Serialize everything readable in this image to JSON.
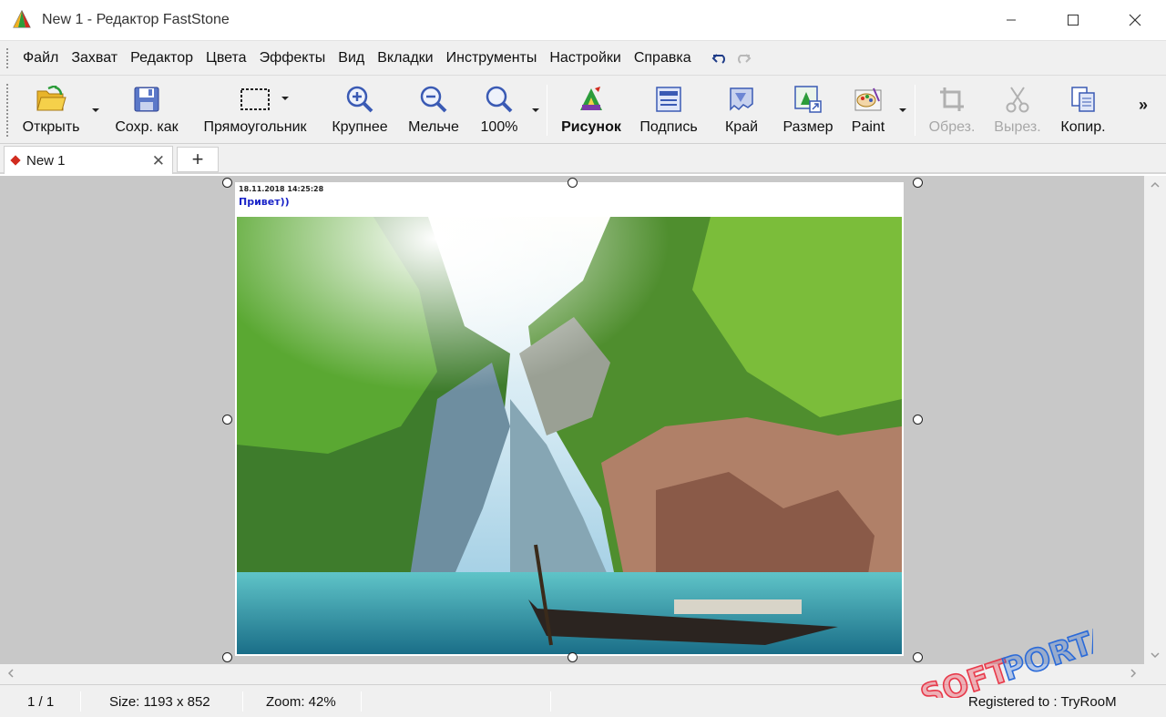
{
  "window": {
    "title": "New 1 - Редактор FastStone",
    "controls": [
      "minimize",
      "maximize",
      "close"
    ]
  },
  "menu": {
    "items": [
      "Файл",
      "Захват",
      "Редактор",
      "Цвета",
      "Эффекты",
      "Вид",
      "Вкладки",
      "Инструменты",
      "Настройки",
      "Справка"
    ],
    "undo_icon": "undo-icon",
    "redo_icon": "redo-icon"
  },
  "toolbar": {
    "open": "Открыть",
    "save_as": "Сохр. как",
    "rectangle": "Прямоугольник",
    "zoom_in": "Крупнее",
    "zoom_out": "Мельче",
    "zoom_100": "100%",
    "draw": "Рисунок",
    "caption": "Подпись",
    "edge": "Край",
    "resize": "Размер",
    "paint": "Paint",
    "crop": "Обрез.",
    "cut": "Вырез.",
    "copy": "Копир.",
    "more": "»"
  },
  "tabs": {
    "active": "New 1",
    "close": "✕",
    "add": "+"
  },
  "canvas": {
    "caption_date": "18.11.2018 14:25:28",
    "caption_text": "Привет))"
  },
  "status": {
    "page": "1 / 1",
    "size": "Size: 1193 x 852",
    "zoom": "Zoom: 42%",
    "registered": "Registered to : TryRooM"
  },
  "watermark": "SOFTPORTAL",
  "colors": {
    "accent_red": "#d12c1f",
    "caption_blue": "#1a24c8",
    "canvas_bg": "#c8c8c8"
  }
}
